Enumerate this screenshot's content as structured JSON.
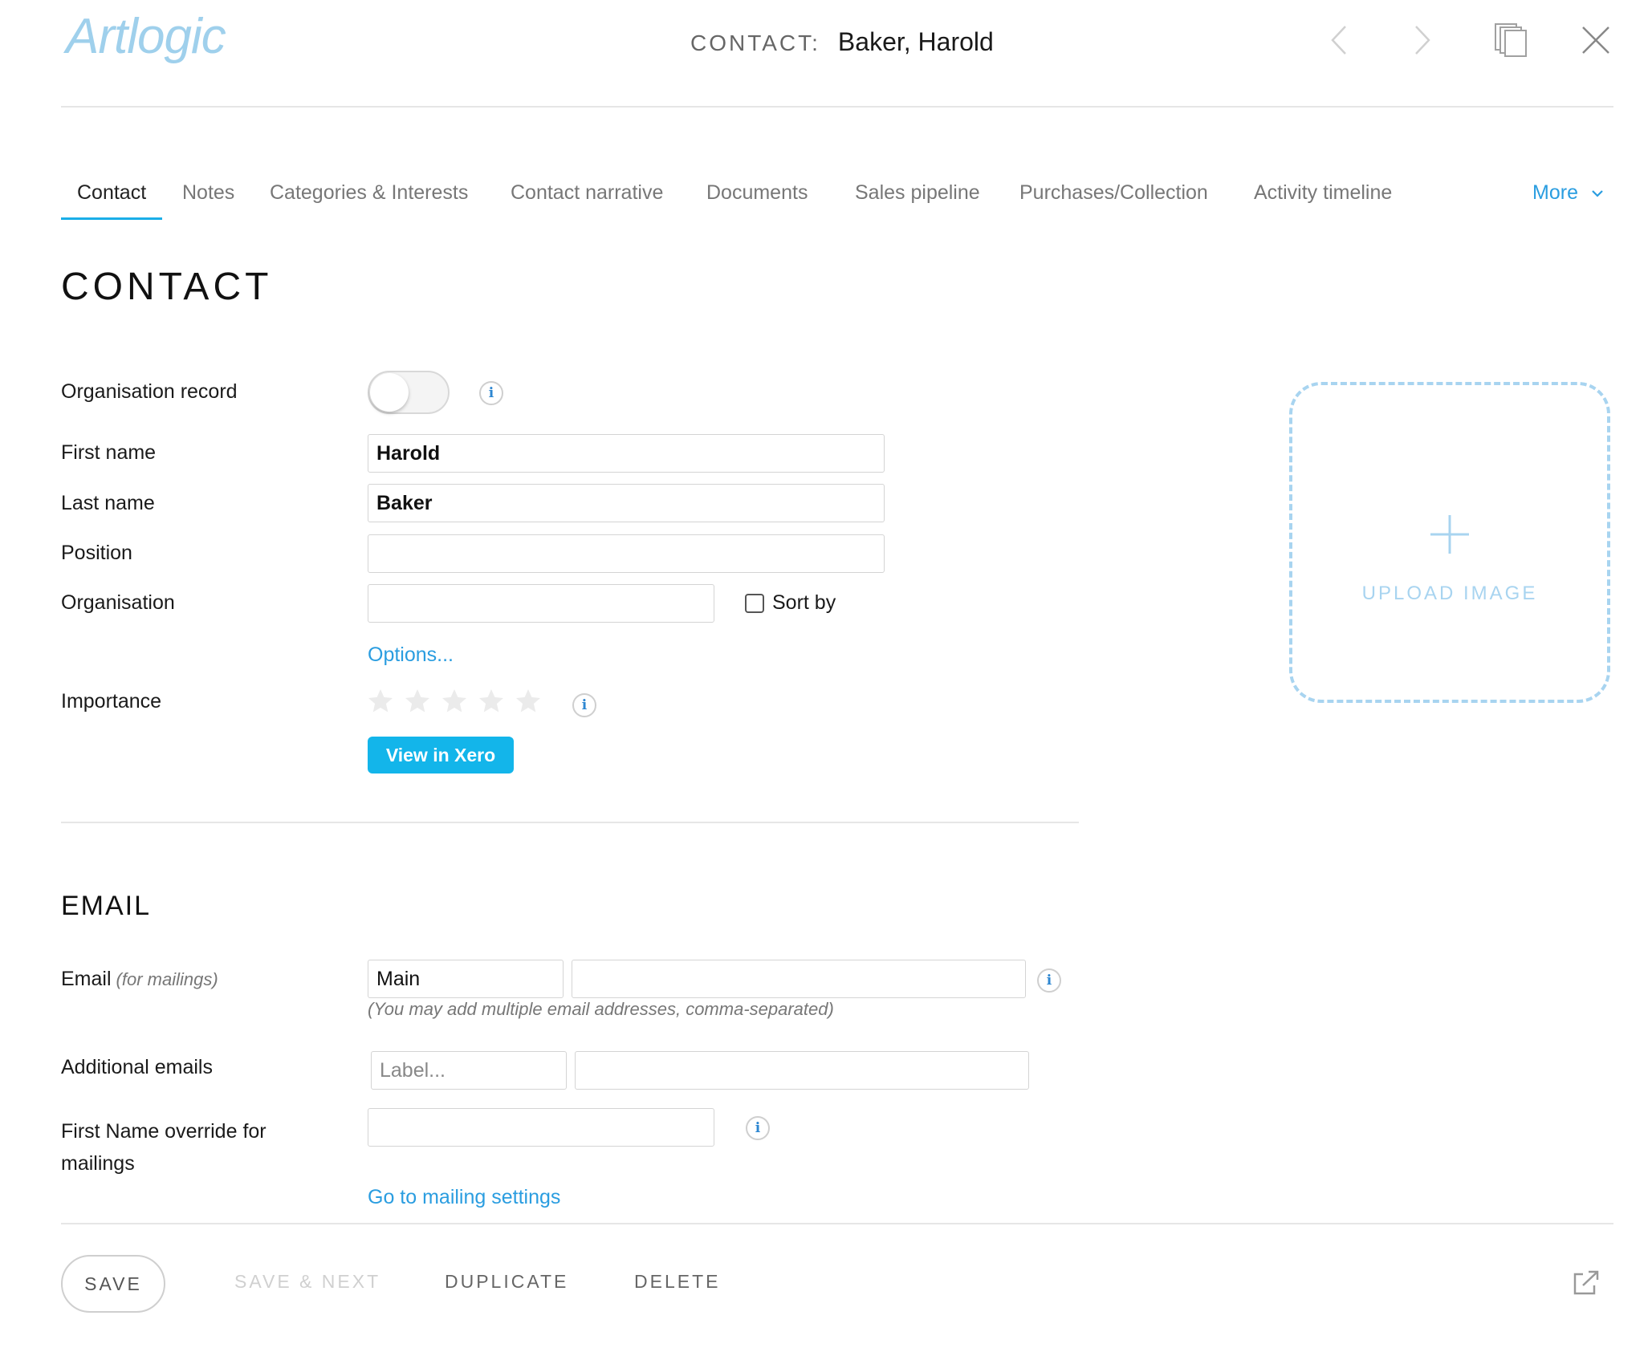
{
  "header": {
    "logo": "Artlogic",
    "contact_prefix": "CONTACT:",
    "contact_name": "Baker, Harold"
  },
  "tabs": [
    {
      "label": "Contact",
      "active": true
    },
    {
      "label": "Notes"
    },
    {
      "label": "Categories & Interests"
    },
    {
      "label": "Contact narrative"
    },
    {
      "label": "Documents"
    },
    {
      "label": "Sales pipeline"
    },
    {
      "label": "Purchases/Collection"
    },
    {
      "label": "Activity timeline"
    }
  ],
  "more_label": "More",
  "contact_section": {
    "title": "CONTACT",
    "organisation_record_label": "Organisation record",
    "organisation_record_on": false,
    "first_name_label": "First name",
    "first_name_value": "Harold",
    "last_name_label": "Last name",
    "last_name_value": "Baker",
    "position_label": "Position",
    "position_value": "",
    "organisation_label": "Organisation",
    "organisation_value": "",
    "sort_by_label": "Sort by",
    "sort_by_checked": false,
    "options_link": "Options...",
    "importance_label": "Importance",
    "importance_rating": 0,
    "importance_max": 5,
    "xero_button": "View in Xero"
  },
  "upload": {
    "label": "UPLOAD IMAGE"
  },
  "email_section": {
    "title": "EMAIL",
    "email_label": "Email",
    "email_hint": "(for mailings)",
    "email_type_value": "Main",
    "email_value": "",
    "helper_text": "(You may add multiple email addresses, comma-separated)",
    "additional_label": "Additional emails",
    "additional_label_placeholder": "Label...",
    "additional_value": "",
    "override_label_line1": "First Name override for",
    "override_label_line2": "mailings",
    "override_value": "",
    "mailing_settings_link": "Go to mailing settings"
  },
  "footer": {
    "save": "SAVE",
    "save_next": "SAVE & NEXT",
    "duplicate": "DUPLICATE",
    "delete": "DELETE"
  },
  "colors": {
    "accent": "#2a9de0",
    "xero": "#13b5ea",
    "logo": "#9fd0ec",
    "upload_border": "#a8d4f0"
  },
  "icons": {
    "prev": "chevron-left-icon",
    "next": "chevron-right-icon",
    "copy": "copy-icon",
    "close": "close-icon",
    "info": "info-icon",
    "star": "star-icon",
    "plus": "plus-icon",
    "popout": "external-link-icon"
  }
}
